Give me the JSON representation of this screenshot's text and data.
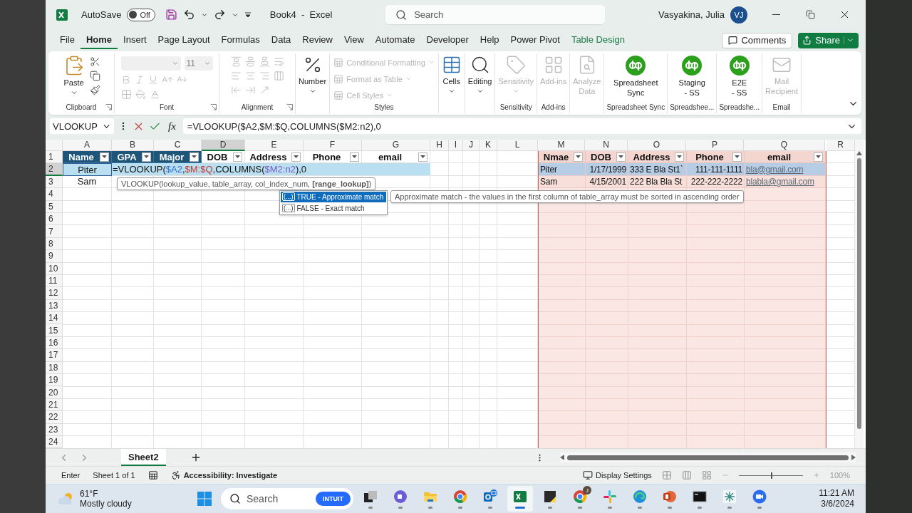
{
  "title_bar": {
    "autosave_label": "AutoSave",
    "autosave": {
      "on": false,
      "text": "Off"
    },
    "document_title": "Book4  -  Excel",
    "search": {
      "placeholder": "Search"
    },
    "user_name": "Vasyakina, Julia",
    "avatar": "VJ"
  },
  "tabs": [
    {
      "label": "File",
      "selected": false,
      "kind": "normal"
    },
    {
      "label": "Home",
      "selected": true,
      "kind": "normal"
    },
    {
      "label": "Insert",
      "selected": false,
      "kind": "normal"
    },
    {
      "label": "Page Layout",
      "selected": false,
      "kind": "normal"
    },
    {
      "label": "Formulas",
      "selected": false,
      "kind": "normal"
    },
    {
      "label": "Data",
      "selected": false,
      "kind": "normal"
    },
    {
      "label": "Review",
      "selected": false,
      "kind": "normal"
    },
    {
      "label": "View",
      "selected": false,
      "kind": "normal"
    },
    {
      "label": "Automate",
      "selected": false,
      "kind": "normal"
    },
    {
      "label": "Developer",
      "selected": false,
      "kind": "normal"
    },
    {
      "label": "Help",
      "selected": false,
      "kind": "normal"
    },
    {
      "label": "Power Pivot",
      "selected": false,
      "kind": "normal"
    },
    {
      "label": "Table Design",
      "selected": false,
      "kind": "contextual"
    }
  ],
  "comments_button": "Comments",
  "share_button": "Share",
  "ribbon": {
    "groups": [
      {
        "kind": "clipboard",
        "label": "Clipboard",
        "launcher": true,
        "buttons": [
          {
            "label": "Paste",
            "disabled": false
          }
        ]
      },
      {
        "kind": "font",
        "label": "Font",
        "launcher": true,
        "font_size": "11",
        "disabled": true
      },
      {
        "kind": "alignment",
        "label": "Alignment",
        "launcher": true,
        "disabled": true
      },
      {
        "kind": "number",
        "buttons": [
          {
            "label": "Number",
            "disabled": false
          }
        ]
      },
      {
        "kind": "styles",
        "label": "Styles",
        "buttons": [
          {
            "label": "Conditional Formatting",
            "disabled": true
          },
          {
            "label": "Format as Table",
            "disabled": true
          },
          {
            "label": "Cell Styles",
            "disabled": true
          }
        ]
      },
      {
        "kind": "cells",
        "buttons": [
          {
            "label": "Cells",
            "disabled": false
          }
        ]
      },
      {
        "kind": "editing",
        "buttons": [
          {
            "label": "Editing",
            "disabled": false
          }
        ]
      },
      {
        "kind": "sensitivity",
        "label": "Sensitivity",
        "buttons": [
          {
            "label": "Sensitivity",
            "disabled": true
          }
        ]
      },
      {
        "kind": "addins",
        "label": "Add-ins",
        "buttons": [
          {
            "label": "Add-ins",
            "disabled": true
          }
        ]
      },
      {
        "kind": "analyze",
        "buttons": [
          {
            "label": "Analyze\nData",
            "disabled": true
          }
        ]
      },
      {
        "kind": "quickbooks",
        "label": "Spreadsheet Sync",
        "buttons": [
          {
            "label": "Spreadsheet\nSync",
            "disabled": false
          }
        ]
      },
      {
        "kind": "quickbooks",
        "label": "Spreadshee...",
        "buttons": [
          {
            "label": "Staging\n- SS",
            "disabled": false
          }
        ]
      },
      {
        "kind": "quickbooks",
        "label": "Spreadshe...",
        "buttons": [
          {
            "label": "E2E\n- SS",
            "disabled": false
          }
        ]
      },
      {
        "kind": "mail",
        "label": "Email",
        "buttons": [
          {
            "label": "Mail\nRecipient",
            "disabled": true
          }
        ]
      }
    ]
  },
  "formula_bar": {
    "name_box": "VLOOKUP",
    "insert_function": "fx",
    "formula": "=VLOOKUP($A2,$M:$Q,COLUMNS($M2:n2),0"
  },
  "sheet": {
    "columns": [
      {
        "label": "A",
        "selected": false
      },
      {
        "label": "B",
        "selected": false
      },
      {
        "label": "C",
        "selected": false
      },
      {
        "label": "D",
        "selected": true
      },
      {
        "label": "E",
        "selected": false
      },
      {
        "label": "F",
        "selected": false
      },
      {
        "label": "G",
        "selected": false
      },
      {
        "label": "H",
        "selected": false
      },
      {
        "label": "I",
        "selected": false
      },
      {
        "label": "J",
        "selected": false
      },
      {
        "label": "K",
        "selected": false
      },
      {
        "label": "L",
        "selected": false
      },
      {
        "label": "M",
        "selected": false
      },
      {
        "label": "N",
        "selected": false
      },
      {
        "label": "O",
        "selected": false
      },
      {
        "label": "P",
        "selected": false
      },
      {
        "label": "Q",
        "selected": false
      },
      {
        "label": "R",
        "selected": false
      }
    ],
    "rows": [
      {
        "label": "1",
        "selected": false
      },
      {
        "label": "2",
        "selected": true
      },
      {
        "label": "3",
        "selected": false
      },
      {
        "label": "4",
        "selected": false
      },
      {
        "label": "5",
        "selected": false
      },
      {
        "label": "6",
        "selected": false
      },
      {
        "label": "7",
        "selected": false
      },
      {
        "label": "8",
        "selected": false
      },
      {
        "label": "9",
        "selected": false
      },
      {
        "label": "10",
        "selected": false
      },
      {
        "label": "11",
        "selected": false
      },
      {
        "label": "12",
        "selected": false
      },
      {
        "label": "13",
        "selected": false
      },
      {
        "label": "14",
        "selected": false
      },
      {
        "label": "15",
        "selected": false
      },
      {
        "label": "16",
        "selected": false
      },
      {
        "label": "17",
        "selected": false
      },
      {
        "label": "18",
        "selected": false
      },
      {
        "label": "19",
        "selected": false
      },
      {
        "label": "20",
        "selected": false
      },
      {
        "label": "21",
        "selected": false
      },
      {
        "label": "22",
        "selected": false
      },
      {
        "label": "23",
        "selected": false
      },
      {
        "label": "24",
        "selected": false
      }
    ],
    "left_table": {
      "headers": [
        {
          "label": "Name",
          "kind": "dark"
        },
        {
          "label": "GPA",
          "kind": "dark"
        },
        {
          "label": "Major",
          "kind": "dark"
        },
        {
          "label": "DOB",
          "kind": "light"
        },
        {
          "label": "Address",
          "kind": "light"
        },
        {
          "label": "Phone",
          "kind": "light"
        },
        {
          "label": "email",
          "kind": "light"
        }
      ],
      "rows": [
        {
          "cell": "Piter",
          "selected": true
        },
        {
          "cell": "Sam",
          "selected": false
        }
      ],
      "formula_in_cell": [
        {
          "text": "=VLOOKUP("
        },
        {
          "text": "$A2",
          "color": "#2f6fd6"
        },
        {
          "text": ","
        },
        {
          "text": "$M:$Q",
          "color": "#c0392b"
        },
        {
          "text": ",COLUMNS("
        },
        {
          "text": "$M2:n2",
          "color": "#7a5cc4"
        },
        {
          "text": "),0"
        }
      ]
    },
    "right_table": {
      "headers": [
        "Nmae",
        "DOB",
        "Address",
        "Phone",
        "email"
      ],
      "rows": [
        {
          "cells": [
            "Piter",
            "1/17/1999",
            "333 E Bla St1`",
            "111-111-1111",
            "bla@gmail.com"
          ],
          "selected": true
        },
        {
          "cells": [
            "Sam",
            "4/15/2001",
            "222 Bla Bla St",
            "222-222-2222",
            "blabla@gmail.com"
          ],
          "selected": false
        }
      ]
    }
  },
  "autocomplete": {
    "syntax": "VLOOKUP(lookup_value, table_array, col_index_num, **[range_lookup]**)",
    "options": [
      {
        "symbol": "(...)",
        "label": "TRUE - Approximate match",
        "selected": true
      },
      {
        "symbol": "(...)",
        "label": "FALSE - Exact match",
        "selected": false
      }
    ],
    "description": "Approximate match - the values in the first column of table_array must be sorted in ascending order"
  },
  "sheet_tabs": [
    {
      "label": "Sheet2",
      "selected": true
    }
  ],
  "status_bar": {
    "mode": "Enter",
    "sheet_info": "Sheet 1 of 1",
    "accessibility": "Accessibility: Investigate",
    "display_settings": "Display Settings",
    "zoom_slider": {
      "level": 0.5
    },
    "zoom": "100%"
  },
  "taskbar": {
    "weather": {
      "temperature": "61°F",
      "condition": "Mostly cloudy"
    },
    "search": {
      "placeholder": "Search",
      "badge": "INTUIT"
    },
    "apps": [
      {
        "kind": "taskview",
        "selected": false
      },
      {
        "kind": "teams",
        "selected": false
      },
      {
        "kind": "explorer",
        "selected": false
      },
      {
        "kind": "chrome",
        "selected": false
      },
      {
        "kind": "outlook",
        "selected": false
      },
      {
        "kind": "excel",
        "selected": true
      },
      {
        "kind": "sticky",
        "selected": false
      },
      {
        "kind": "chrome",
        "selected": false,
        "badge": "J"
      },
      {
        "kind": "slack",
        "selected": false
      },
      {
        "kind": "edge",
        "selected": false
      },
      {
        "kind": "powerpoint",
        "selected": false
      },
      {
        "kind": "terminal",
        "selected": false
      },
      {
        "kind": "grid",
        "selected": false
      },
      {
        "kind": "zoom",
        "selected": false
      }
    ],
    "time": "11:21 AM",
    "date": "3/6/2024"
  }
}
